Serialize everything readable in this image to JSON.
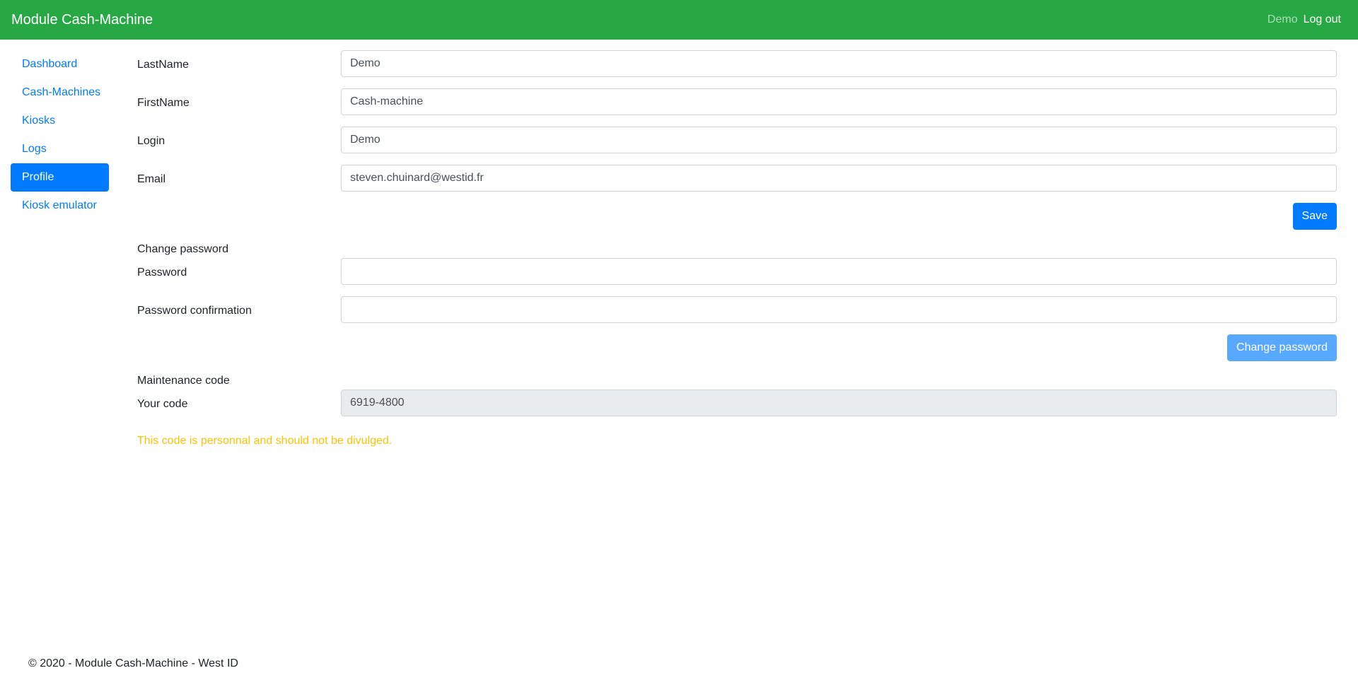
{
  "navbar": {
    "brand": "Module Cash-Machine",
    "user": "Demo",
    "logout": "Log out"
  },
  "sidebar": {
    "items": [
      {
        "label": "Dashboard"
      },
      {
        "label": "Cash-Machines"
      },
      {
        "label": "Kiosks"
      },
      {
        "label": "Logs"
      },
      {
        "label": "Profile",
        "active": true
      },
      {
        "label": "Kiosk emulator"
      }
    ]
  },
  "profile": {
    "lastname_label": "LastName",
    "lastname_value": "Demo",
    "firstname_label": "FirstName",
    "firstname_value": "Cash-machine",
    "login_label": "Login",
    "login_value": "Demo",
    "email_label": "Email",
    "email_value": "steven.chuinard@westid.fr",
    "save_label": "Save"
  },
  "password": {
    "section_title": "Change password",
    "password_label": "Password",
    "password_value": "",
    "confirmation_label": "Password confirmation",
    "confirmation_value": "",
    "button_label": "Change password"
  },
  "maintenance": {
    "section_title": "Maintenance code",
    "code_label": "Your code",
    "code_value": "6919-4800",
    "warning": "This code is personnal and should not be divulged."
  },
  "footer": {
    "text": "© 2020 - Module Cash-Machine - West ID"
  },
  "colors": {
    "navbar": "#28a745",
    "primary": "#007bff",
    "warning": "#ffc107"
  }
}
